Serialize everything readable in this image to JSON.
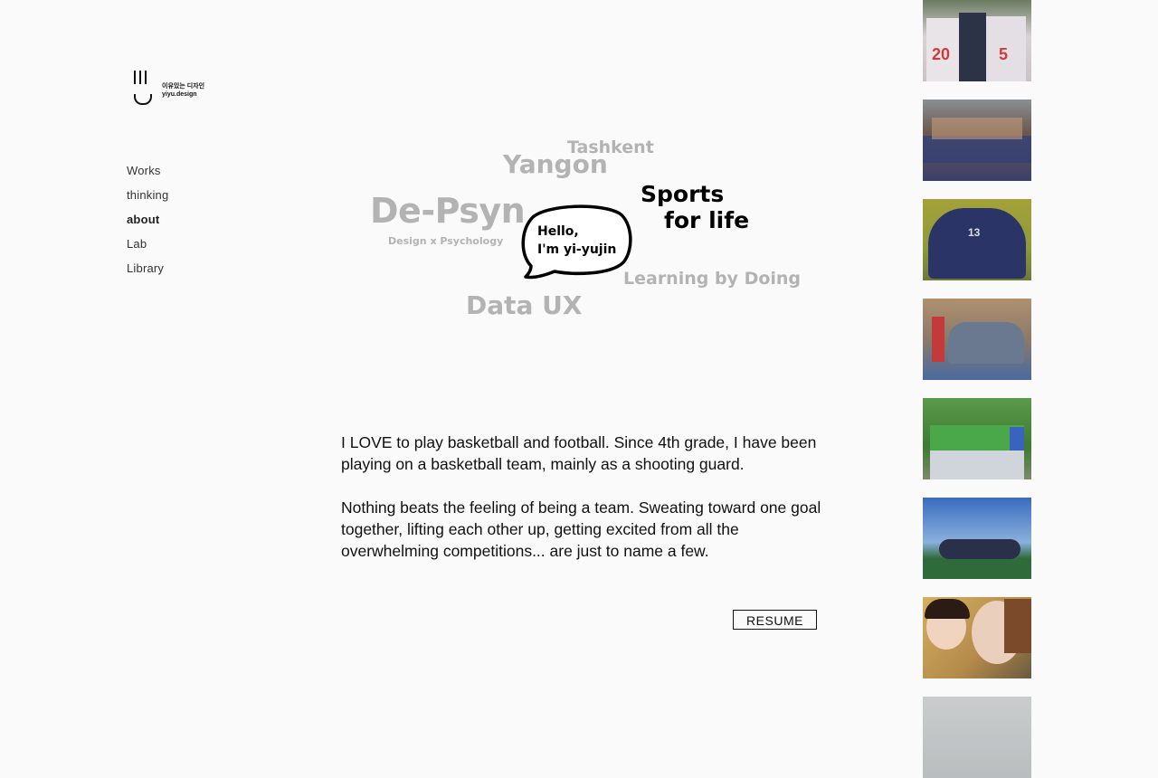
{
  "logo": {
    "line1": "이유있는 디자인",
    "line2": "yiyu.design"
  },
  "nav": {
    "items": [
      {
        "label": "Works",
        "active": false
      },
      {
        "label": "thinking",
        "active": false
      },
      {
        "label": "about",
        "active": true
      },
      {
        "label": "Lab",
        "active": false
      },
      {
        "label": "Library",
        "active": false
      }
    ]
  },
  "cloud": {
    "tashkent": "Tashkent",
    "yangon": "Yangon",
    "depsyn": "De-Psyn",
    "depsyn_sub": "Design x Psychology",
    "sports_line1": "Sports",
    "sports_line2": "for life",
    "learning": "Learning by Doing",
    "data_ux": "Data UX",
    "bubble_line1": "Hello,",
    "bubble_line2": "I'm yi-yujin"
  },
  "about": {
    "paragraph1": "I LOVE to play basketball and football. Since 4th grade, I have been playing on a basketball team, mainly as a shooting guard.",
    "paragraph2": "Nothing beats the feeling of being a team. Sweating toward one goal together, lifting each other up, getting excited from all the overwhelming competitions... are just to name a few."
  },
  "resume_button": "RESUME",
  "photos": [
    {
      "name": "photo-team-jerseys",
      "bg": "#5b6a58"
    },
    {
      "name": "photo-team-huddle-floor",
      "bg": "#7a6a58"
    },
    {
      "name": "photo-team-circle-yellow-wall",
      "bg": "#9a9a3a"
    },
    {
      "name": "photo-team-group-gym",
      "bg": "#8a7a5a"
    },
    {
      "name": "photo-team-green-shirts",
      "bg": "#4d8a3c"
    },
    {
      "name": "photo-team-field-sky",
      "bg": "#3f6fa8"
    },
    {
      "name": "photo-medal-selfie",
      "bg": "#b89a4a"
    },
    {
      "name": "photo-gray",
      "bg": "#c8cccc"
    }
  ]
}
